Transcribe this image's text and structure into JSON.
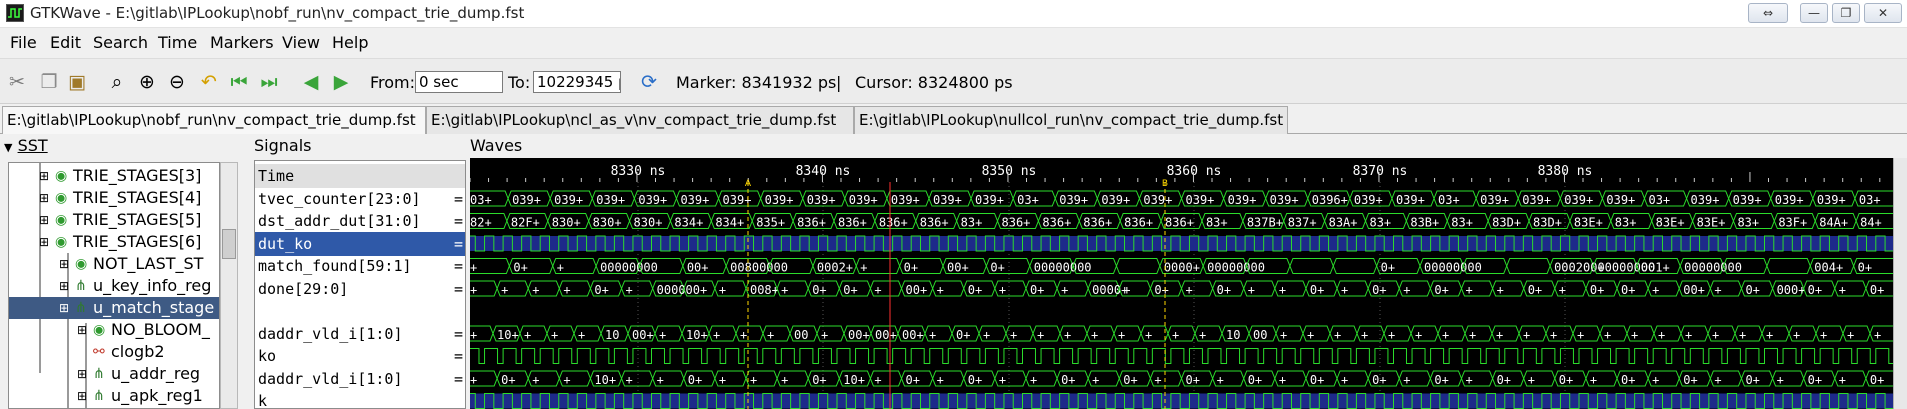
{
  "window": {
    "title": "GTKWave - E:\\gitlab\\IPLookup\\nobf_run\\nv_compact_trie_dump.fst",
    "controls": [
      "⇔",
      "—",
      "❐",
      "✕"
    ]
  },
  "menu": [
    "File",
    "Edit",
    "Search",
    "Time",
    "Markers",
    "View",
    "Help"
  ],
  "toolbar": {
    "from_label": "From:",
    "from_value": "0 sec",
    "to_label": "To:",
    "to_value": "10229345 ps",
    "marker_text": "Marker: 8341932 ps",
    "separator": "|",
    "cursor_text": "Cursor: 8324800 ps",
    "icons": [
      "cut-icon",
      "copy-icon",
      "paste-icon",
      "zoom-fit-icon",
      "zoom-in-icon",
      "zoom-out-icon",
      "undo-zoom-icon",
      "zoom-start-icon",
      "zoom-end-icon",
      "back-icon",
      "forward-icon",
      "reload-icon"
    ]
  },
  "tabs": [
    "E:\\gitlab\\IPLookup\\nobf_run\\nv_compact_trie_dump.fst",
    "E:\\gitlab\\IPLookup\\ncl_as_v\\nv_compact_trie_dump.fst",
    "E:\\gitlab\\IPLookup\\nullcol_run\\nv_compact_trie_dump.fst"
  ],
  "sst": {
    "header": "SST",
    "items": [
      {
        "label": "TRIE_STAGES[3]",
        "depth": 0,
        "type": "module"
      },
      {
        "label": "TRIE_STAGES[4]",
        "depth": 0,
        "type": "module"
      },
      {
        "label": "TRIE_STAGES[5]",
        "depth": 0,
        "type": "module"
      },
      {
        "label": "TRIE_STAGES[6]",
        "depth": 0,
        "type": "module"
      },
      {
        "label": "NOT_LAST_ST",
        "depth": 1,
        "type": "module"
      },
      {
        "label": "u_key_info_reg",
        "depth": 1,
        "type": "instance"
      },
      {
        "label": "u_match_stage",
        "depth": 1,
        "type": "instance",
        "selected": true
      },
      {
        "label": "NO_BLOOM_",
        "depth": 2,
        "type": "module"
      },
      {
        "label": "clogb2",
        "depth": 2,
        "type": "function"
      },
      {
        "label": "u_addr_reg",
        "depth": 2,
        "type": "instance"
      },
      {
        "label": "u_apk_reg1",
        "depth": 2,
        "type": "instance"
      }
    ]
  },
  "signals": {
    "header": "Signals",
    "rows": [
      {
        "label": "Time",
        "kind": "header"
      },
      {
        "label": "tvec_counter[23:0]",
        "eq": "="
      },
      {
        "label": "dst_addr_dut[31:0]",
        "eq": "="
      },
      {
        "label": "dut_ko",
        "eq": "=",
        "selected": true
      },
      {
        "label": "match_found[59:1]",
        "eq": "="
      },
      {
        "label": "done[29:0]",
        "eq": "="
      },
      {
        "label": "",
        "eq": ""
      },
      {
        "label": "daddr_vld_i[1:0]",
        "eq": "="
      },
      {
        "label": "ko",
        "eq": "="
      },
      {
        "label": "daddr_vld_i[1:0]",
        "eq": "="
      },
      {
        "label": "k",
        "eq": ""
      }
    ]
  },
  "waves": {
    "header": "Waves",
    "time_ticks": [
      "8330 ns",
      "8340 ns",
      "8350 ns",
      "8360 ns",
      "8370 ns",
      "8380 ns"
    ],
    "marker_labels": [
      "A",
      "B"
    ],
    "tracks": [
      {
        "type": "bus",
        "values": [
          "03+",
          "039+",
          "039+",
          "039+",
          "039+",
          "039+",
          "039+",
          "039+",
          "039+",
          "039+",
          "039+",
          "039+",
          "039+",
          "03+",
          "039+",
          "039+",
          "039+",
          "039+",
          "039+",
          "039+",
          "0396+",
          "039+",
          "039+",
          "03+",
          "039+",
          "039+",
          "039+",
          "039+",
          "03+",
          "039+",
          "039+",
          "039+",
          "039+",
          "03+"
        ]
      },
      {
        "type": "bus",
        "values": [
          "82+",
          "82F+",
          "830+",
          "830+",
          "830+",
          "834+",
          "834+",
          "835+",
          "836+",
          "836+",
          "836+",
          "836+",
          "83+",
          "836+",
          "836+",
          "836+",
          "836+",
          "836+",
          "83+",
          "837B+",
          "837+",
          "83A+",
          "83+",
          "83B+",
          "83+",
          "83D+",
          "83D+",
          "83E+",
          "83+",
          "83E+",
          "83E+",
          "83+",
          "83F+",
          "84A+",
          "84+"
        ]
      },
      {
        "type": "bit",
        "pattern": "clock"
      },
      {
        "type": "bus",
        "values": [
          "+",
          "0+",
          "+",
          "00000000",
          "",
          "00+",
          "00800000",
          "",
          "0002+",
          "+",
          "0+",
          "00+",
          "0+",
          "00000000",
          "",
          "",
          "0000+",
          "00000000",
          "",
          "",
          "",
          "0+",
          "00000000",
          "",
          "",
          "000200+",
          "00000000",
          "001+",
          "00000000",
          "",
          "",
          "004+",
          "0+"
        ]
      },
      {
        "type": "bus",
        "values": [
          "+",
          "+",
          "+",
          "+",
          "0+",
          "+",
          "000000+",
          "",
          "+",
          "008+",
          "+",
          "0+",
          "0+",
          "+",
          "00+",
          "+",
          "0+",
          "+",
          "0+",
          "+",
          "0000+",
          "+",
          "0+",
          "+",
          "0+",
          "+",
          "+",
          "0+",
          "+",
          "0+",
          "+",
          "0+",
          "+",
          "+",
          "0+",
          "+",
          "0+",
          "0+",
          "+",
          "00+",
          "+",
          "0+",
          "000+",
          "0+",
          "+",
          "0+"
        ]
      },
      {
        "type": "empty"
      },
      {
        "type": "bus",
        "values": [
          "+",
          "10+",
          "+",
          "+",
          "+",
          "10",
          "00+",
          "+",
          "10+",
          "+",
          "+",
          "+",
          "00",
          "+",
          "00+",
          "00+",
          "00+",
          "+",
          "0+",
          "+",
          "+",
          "+",
          "+",
          "+",
          "+",
          "+",
          "+",
          "+",
          "10",
          "00",
          "+",
          "+",
          "+",
          "+",
          "+",
          "+",
          "+",
          "+",
          "+",
          "+",
          "+",
          "+",
          "+",
          "+",
          "+",
          "+",
          "+",
          "+",
          "+",
          "+",
          "+",
          "+",
          "+"
        ]
      },
      {
        "type": "bit",
        "pattern": "pulse"
      },
      {
        "type": "bus",
        "values": [
          "+",
          "0+",
          "+",
          "+",
          "10+",
          "+",
          "+",
          "0+",
          "+",
          "+",
          "+",
          "0+",
          "10+",
          "+",
          "0+",
          "+",
          "0+",
          "+",
          "+",
          "0+",
          "+",
          "0+",
          "+",
          "0+",
          "+",
          "0+",
          "+",
          "0+",
          "+",
          "0+",
          "+",
          "0+",
          "+",
          "0+",
          "+",
          "0+",
          "+",
          "0+",
          "+",
          "0+",
          "+",
          "0+",
          "+",
          "0+",
          "+",
          "0+"
        ]
      },
      {
        "type": "bit",
        "pattern": "clock"
      }
    ]
  }
}
